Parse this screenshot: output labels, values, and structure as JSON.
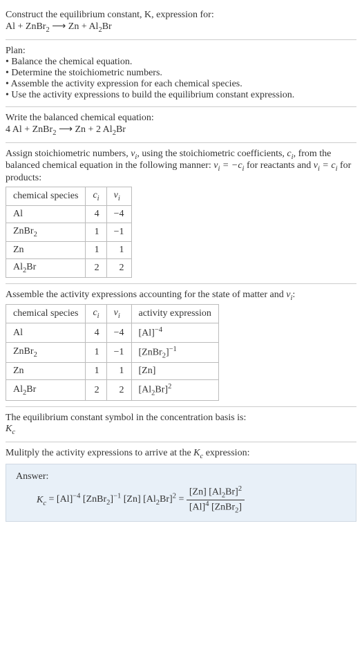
{
  "header": {
    "prompt": "Construct the equilibrium constant, K, expression for:",
    "unbalanced": "Al + ZnBr₂ ⟶ Zn + Al₂Br"
  },
  "plan": {
    "title": "Plan:",
    "items": [
      "Balance the chemical equation.",
      "Determine the stoichiometric numbers.",
      "Assemble the activity expression for each chemical species.",
      "Use the activity expressions to build the equilibrium constant expression."
    ]
  },
  "balanced": {
    "intro": "Write the balanced chemical equation:",
    "equation": "4 Al + ZnBr₂ ⟶ Zn + 2 Al₂Br"
  },
  "assign": {
    "intro_a": "Assign stoichiometric numbers, ",
    "intro_b": ", using the stoichiometric coefficients, ",
    "intro_c": ", from the balanced chemical equation in the following manner: ",
    "intro_d": " for reactants and ",
    "intro_e": " for products:",
    "nu": "νᵢ",
    "ci": "cᵢ",
    "eq_react": "νᵢ = −cᵢ",
    "eq_prod": "νᵢ = cᵢ"
  },
  "table1": {
    "headers": [
      "chemical species",
      "cᵢ",
      "νᵢ"
    ],
    "rows": [
      [
        "Al",
        "4",
        "−4"
      ],
      [
        "ZnBr₂",
        "1",
        "−1"
      ],
      [
        "Zn",
        "1",
        "1"
      ],
      [
        "Al₂Br",
        "2",
        "2"
      ]
    ]
  },
  "activity": {
    "intro": "Assemble the activity expressions accounting for the state of matter and νᵢ:"
  },
  "table2": {
    "headers": [
      "chemical species",
      "cᵢ",
      "νᵢ",
      "activity expression"
    ],
    "rows": [
      {
        "sp": "Al",
        "c": "4",
        "v": "−4",
        "expr_base": "[Al]",
        "expr_sup": "−4"
      },
      {
        "sp": "ZnBr₂",
        "c": "1",
        "v": "−1",
        "expr_base": "[ZnBr₂]",
        "expr_sup": "−1"
      },
      {
        "sp": "Zn",
        "c": "1",
        "v": "1",
        "expr_base": "[Zn]",
        "expr_sup": ""
      },
      {
        "sp": "Al₂Br",
        "c": "2",
        "v": "2",
        "expr_base": "[Al₂Br]",
        "expr_sup": "2"
      }
    ]
  },
  "kc_symbol": {
    "intro": "The equilibrium constant symbol in the concentration basis is:",
    "symbol": "K꜀"
  },
  "multiply": {
    "intro": "Mulitply the activity expressions to arrive at the K꜀ expression:"
  },
  "answer": {
    "label": "Answer:",
    "lhs": "K꜀ = ",
    "flat": "[Al]⁻⁴ [ZnBr₂]⁻¹ [Zn] [Al₂Br]² = ",
    "frac_top": "[Zn] [Al₂Br]²",
    "frac_bot": "[Al]⁴ [ZnBr₂]"
  }
}
